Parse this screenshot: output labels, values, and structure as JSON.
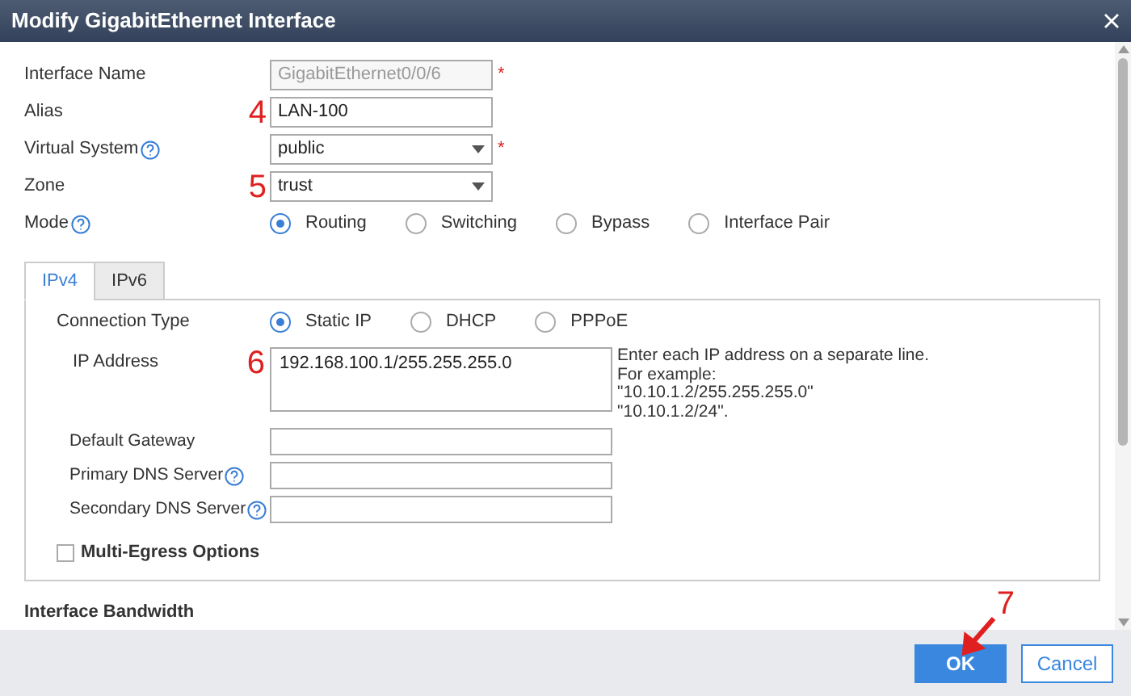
{
  "window": {
    "title": "Modify GigabitEthernet Interface"
  },
  "fields": [
    {
      "label": "Interface Name",
      "kind": "text",
      "value": "GigabitEthernet0/0/6",
      "disabled": true,
      "required_mark": "*",
      "help": false
    },
    {
      "label": "Alias",
      "kind": "text",
      "value": "LAN-100",
      "marker": "4",
      "disabled": false,
      "help": false
    },
    {
      "label": "Virtual System",
      "kind": "select",
      "value": "public",
      "disabled": false,
      "required_mark": "*",
      "help": true
    },
    {
      "label": "Zone",
      "kind": "select",
      "value": "trust",
      "marker": "5",
      "disabled": false,
      "help": false
    },
    {
      "label": "Mode",
      "kind": "radio",
      "help": true,
      "options": [
        {
          "label": "Routing",
          "selected": true
        },
        {
          "label": "Switching",
          "selected": false
        },
        {
          "label": "Bypass",
          "selected": false
        },
        {
          "label": "Interface Pair",
          "selected": false
        }
      ]
    }
  ],
  "tabs": [
    {
      "label": "IPv4",
      "selected": true
    },
    {
      "label": "IPv6",
      "selected": false
    }
  ],
  "ipv4": {
    "connection_type": {
      "label": "Connection Type",
      "options": [
        {
          "label": "Static IP",
          "selected": true
        },
        {
          "label": "DHCP",
          "selected": false
        },
        {
          "label": "PPPoE",
          "selected": false
        }
      ]
    },
    "ip_address": {
      "label": "IP Address",
      "marker": "6",
      "value": "192.168.100.1/255.255.255.0",
      "hint": [
        "Enter each IP address on a separate line.",
        "For example:",
        "\"10.10.1.2/255.255.255.0\"",
        "\"10.10.1.2/24\"."
      ]
    },
    "fields": [
      {
        "label": "Default Gateway",
        "help": false
      },
      {
        "label": "Primary DNS Server",
        "help": true
      },
      {
        "label": "Secondary DNS Server",
        "help": true
      }
    ],
    "multi_egress": {
      "label": "Multi-Egress Options",
      "checked": false
    }
  },
  "section": "Interface Bandwidth",
  "buttons": [
    {
      "label": "OK",
      "primary": true,
      "marker": "7"
    },
    {
      "label": "Cancel",
      "primary": false
    }
  ]
}
